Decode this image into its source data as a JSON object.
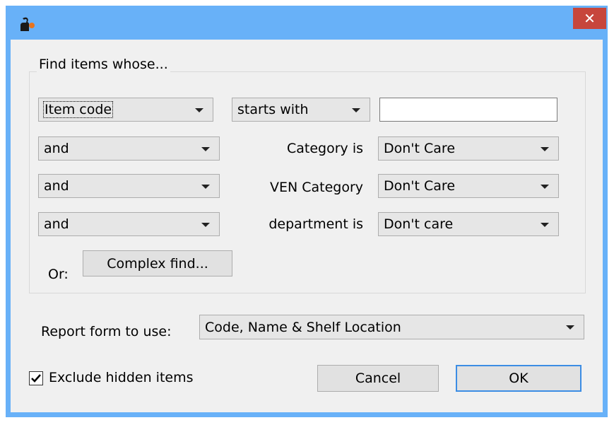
{
  "window": {
    "close_label": "✕"
  },
  "find_group": {
    "title": "Find items whose...",
    "field_select": "Item code",
    "operator_select": "starts with",
    "search_value": "",
    "rows": [
      {
        "conjunction": "and",
        "label": "Category is",
        "value": "Don't Care"
      },
      {
        "conjunction": "and",
        "label": "VEN Category",
        "value": "Don't Care"
      },
      {
        "conjunction": "and",
        "label": "department is",
        "value": "Don't care"
      }
    ],
    "or_label": "Or:",
    "complex_find_label": "Complex find..."
  },
  "report": {
    "label": "Report form to use:",
    "value": "Code, Name & Shelf Location"
  },
  "exclude_hidden": {
    "label": "Exclude hidden items",
    "checked": true
  },
  "buttons": {
    "cancel": "Cancel",
    "ok": "OK"
  }
}
